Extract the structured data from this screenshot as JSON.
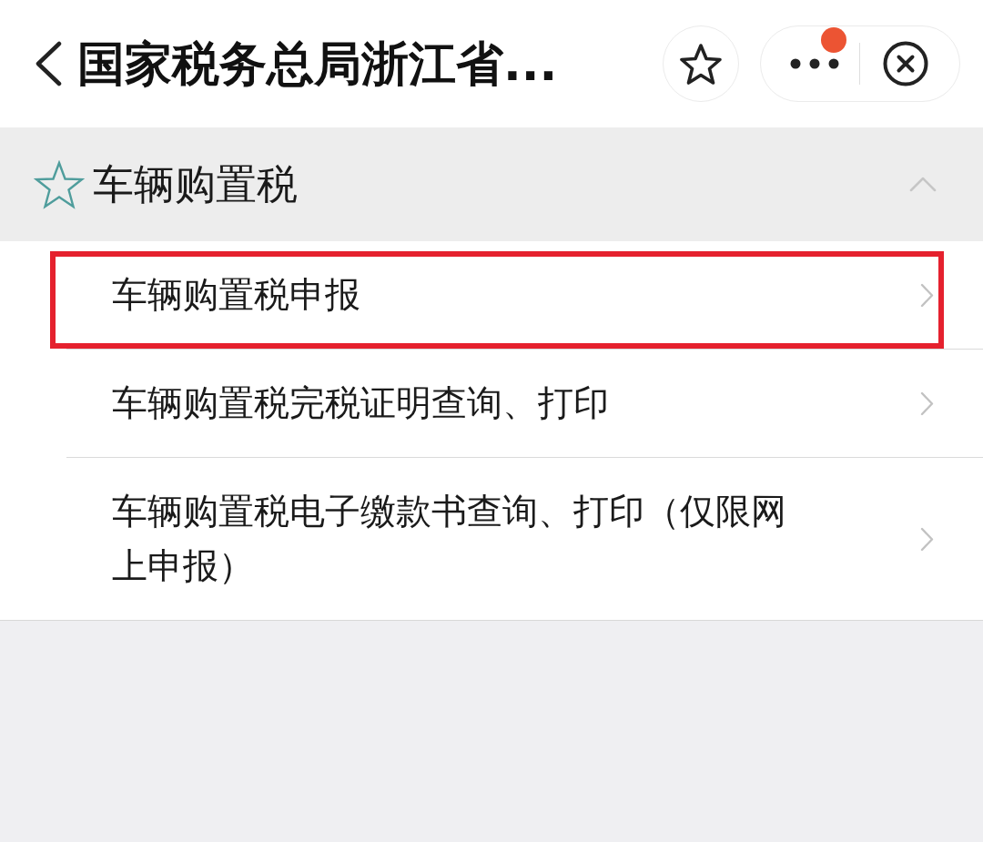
{
  "header": {
    "title": "国家税务总局浙江省...",
    "favorited": false,
    "more_badge": true
  },
  "section": {
    "title": "车辆购置税",
    "expanded": true,
    "items": [
      {
        "label": "车辆购置税申报",
        "highlighted": true
      },
      {
        "label": "车辆购置税完税证明查询、打印",
        "highlighted": false
      },
      {
        "label": "车辆购置税电子缴款书查询、打印（仅限网上申报）",
        "highlighted": false
      }
    ]
  }
}
